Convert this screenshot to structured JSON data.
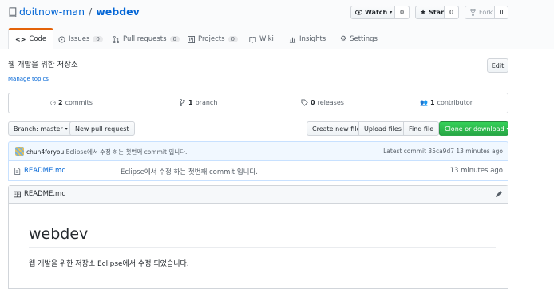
{
  "repo": {
    "owner": "doitnow-man",
    "separator": "/",
    "name": "webdev"
  },
  "actions": {
    "watch_label": "Watch",
    "watch_count": "0",
    "star_label": "Star",
    "star_count": "0",
    "fork_label": "Fork",
    "fork_count": "0"
  },
  "tabs": [
    {
      "label": "Code"
    },
    {
      "label": "Issues",
      "count": "0"
    },
    {
      "label": "Pull requests",
      "count": "0"
    },
    {
      "label": "Projects",
      "count": "0"
    },
    {
      "label": "Wiki"
    },
    {
      "label": "Insights"
    },
    {
      "label": "Settings"
    }
  ],
  "description": "웹 개발을 위한 저장소",
  "manage_topics": "Manage topics",
  "edit_label": "Edit",
  "summary": {
    "commits_count": "2",
    "commits_label": "commits",
    "branches_count": "1",
    "branches_label": "branch",
    "releases_count": "0",
    "releases_label": "releases",
    "contributors_count": "1",
    "contributors_label": "contributor"
  },
  "file_nav": {
    "branch_label": "Branch: master",
    "new_pr": "New pull request",
    "create_file": "Create new file",
    "upload_files": "Upload files",
    "find_file": "Find file",
    "clone": "Clone or download"
  },
  "commit_tease": {
    "author": "chun4foryou",
    "message": "Eclipse에서 수정 하는 첫번째 commit 입니다.",
    "latest": "Latest commit 35ca9d7 13 minutes ago"
  },
  "files": [
    {
      "name": "README.md",
      "message": "Eclipse에서 수정 하는 첫번째 commit 입니다.",
      "age": "13 minutes ago"
    }
  ],
  "readme": {
    "label": "README.md",
    "heading": "webdev",
    "paragraph": "웹 개발을 위한 저장소 Eclipse에서 수정 되었습니다."
  }
}
